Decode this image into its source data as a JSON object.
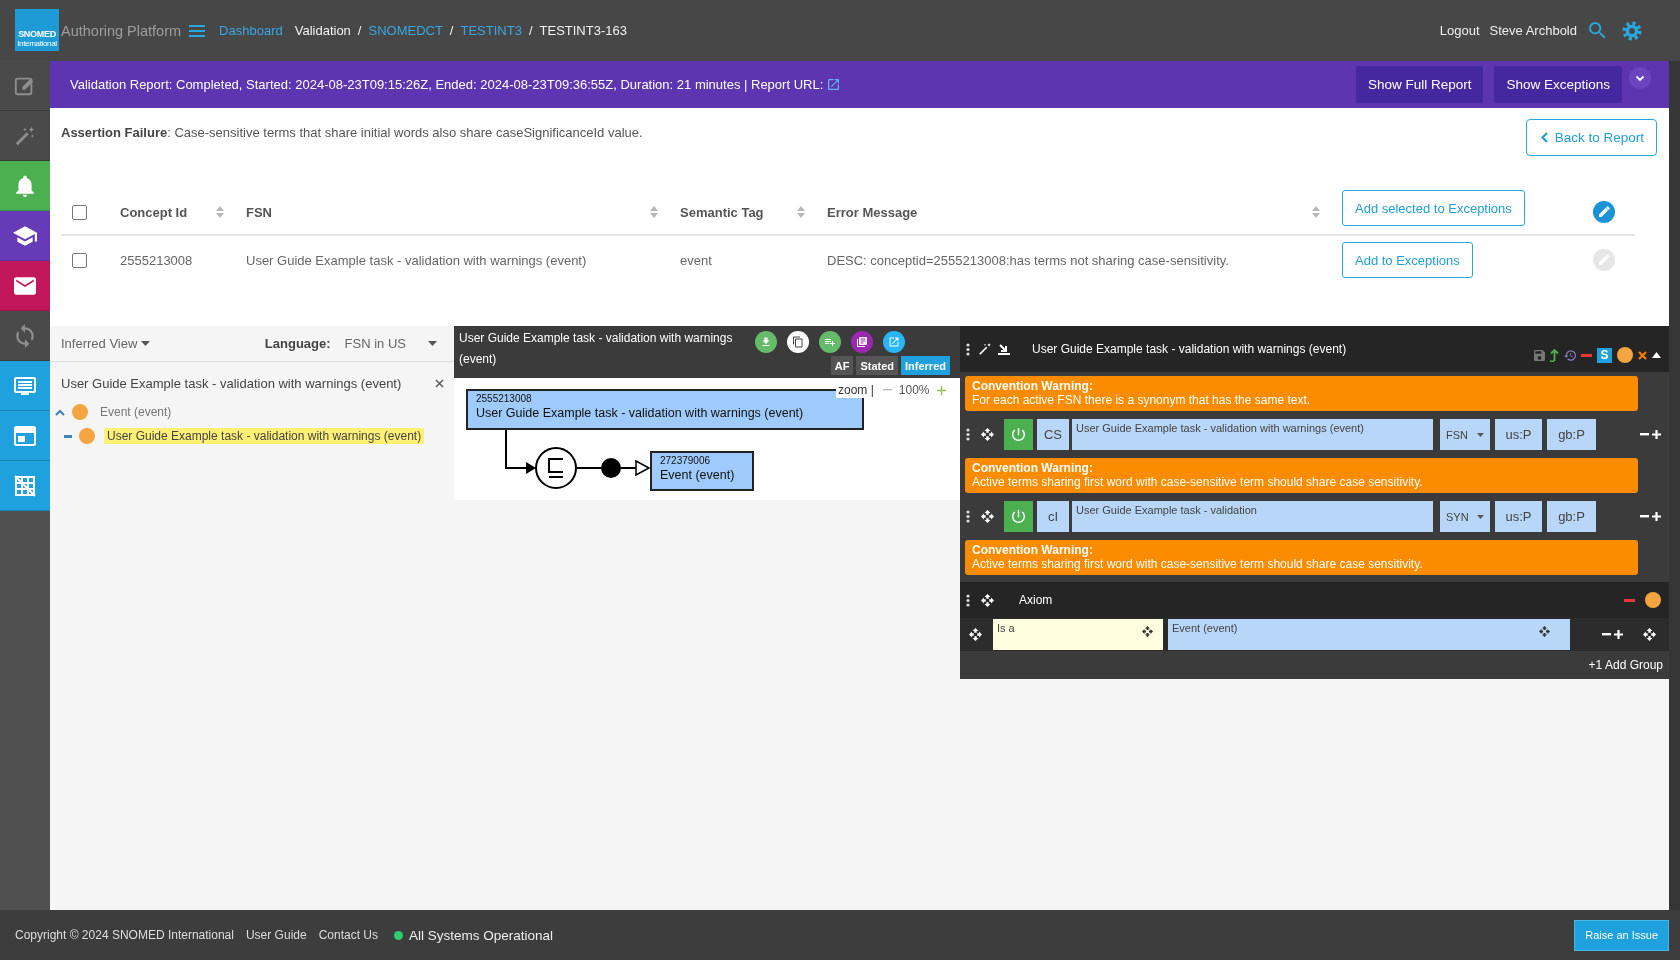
{
  "header": {
    "logo": {
      "name": "SNOMED",
      "tagline": "International"
    },
    "app_title": "Authoring Platform",
    "breadcrumbs": [
      {
        "kind": "link",
        "label": "Dashboard"
      },
      {
        "kind": "text",
        "label": "Validation"
      },
      {
        "kind": "separator",
        "label": "/"
      },
      {
        "kind": "link",
        "label": "SNOMEDCT"
      },
      {
        "kind": "separator",
        "label": "/"
      },
      {
        "kind": "link",
        "label": "TESTINT3"
      },
      {
        "kind": "separator",
        "label": "/"
      },
      {
        "kind": "text",
        "label": "TESTINT3-163"
      }
    ],
    "logout": "Logout",
    "user": "Steve Archbold"
  },
  "sidebar": {
    "items": [
      {
        "kind": "edit",
        "color": "#4a4a4a"
      },
      {
        "kind": "wand",
        "color": "#4a4a4a"
      },
      {
        "kind": "bell",
        "color": "#4caf50"
      },
      {
        "kind": "school",
        "color": "#673ab7"
      },
      {
        "kind": "mail",
        "color": "#c2185b"
      },
      {
        "kind": "sync",
        "color": "#4a4a4a"
      },
      {
        "kind": "monitor",
        "color": "#1ea1dc"
      },
      {
        "kind": "window",
        "color": "#1ea1dc"
      },
      {
        "kind": "grid",
        "color": "#1ea1dc"
      }
    ]
  },
  "banner": {
    "text": "Validation Report: Completed, Started: 2024-08-23T09:15:26Z, Ended: 2024-08-23T09:36:55Z, Duration: 21 minutes | Report URL:",
    "buttons": [
      "Show Full Report",
      "Show Exceptions"
    ]
  },
  "assertion": "**Assertion Failure**: Case-sensitive terms that share initial words also share caseSignificanceId value.",
  "back_button": "Back to Report",
  "table": {
    "header_checked": false,
    "columns": [
      {
        "label": "Concept Id",
        "sortable": true
      },
      {
        "label": "FSN",
        "sortable": true
      },
      {
        "label": "Semantic Tag",
        "sortable": true
      },
      {
        "label": "Error Message",
        "sortable": true
      }
    ],
    "header_action": "Add selected to Exceptions",
    "header_edit_disabled": false,
    "rows": [
      {
        "checked": false,
        "concept_id": "2555213008",
        "fsn": "User Guide Example task - validation with warnings (event)",
        "semantic_tag": "event",
        "error_message": "DESC: conceptid=2555213008:has terms not sharing case-sensitivity.",
        "action": "Add to Exceptions",
        "edit_disabled": true
      }
    ]
  },
  "taxonomy": {
    "view": "Inferred View",
    "language_label": "Language:",
    "language": "FSN in US",
    "title": "User Guide Example task - validation with warnings (event)",
    "tree": [
      {
        "label": "Event (event)",
        "expanded": true,
        "selected": false,
        "children": [
          {
            "label": "User Guide Example task - validation with warnings (event)",
            "selected": true
          }
        ]
      }
    ]
  },
  "diagram": {
    "title": "User Guide Example task - validation with warnings (event)",
    "views": [
      {
        "label": "AF",
        "selected": false
      },
      {
        "label": "Stated",
        "selected": false
      },
      {
        "label": "Inferred",
        "selected": true
      }
    ],
    "zoom_label": "zoom |",
    "zoom_value": "100%",
    "concept": {
      "id": "2555213008",
      "label": "User Guide Example task - validation with warnings (event)"
    },
    "parent": {
      "id": "272379006",
      "label": "Event (event)"
    }
  },
  "editor": {
    "title": "User Guide Example task - validation with warnings (event)",
    "badge": "S",
    "items": [
      {
        "kind": "warning",
        "title": "Convention Warning:",
        "text": "For each active FSN there is a synonym that has the same text."
      },
      {
        "kind": "description",
        "active": true,
        "case": "CS",
        "term": "User Guide Example task - validation with warnings (event)",
        "type": "FSN",
        "us": "us:P",
        "gb": "gb:P"
      },
      {
        "kind": "warning",
        "title": "Convention Warning:",
        "text": "Active terms sharing first word with case-sensitive term should share case sensitivity."
      },
      {
        "kind": "description",
        "active": true,
        "case": "cI",
        "term": "User Guide Example task - validation",
        "type": "SYN",
        "us": "us:P",
        "gb": "gb:P"
      },
      {
        "kind": "warning",
        "title": "Convention Warning:",
        "text": "Active terms sharing first word with case-sensitive term should share case sensitivity."
      }
    ],
    "axiom": {
      "title": "Axiom",
      "relationships": [
        {
          "type": "Is a",
          "target": "Event (event)"
        }
      ]
    },
    "add_group": "+1 Add Group"
  },
  "footer": {
    "copyright": "Copyright © 2024 SNOMED International",
    "links": [
      "User Guide",
      "Contact Us"
    ],
    "status": {
      "label": "All Systems Operational",
      "operational": true
    },
    "raise_issue": "Raise an Issue"
  }
}
